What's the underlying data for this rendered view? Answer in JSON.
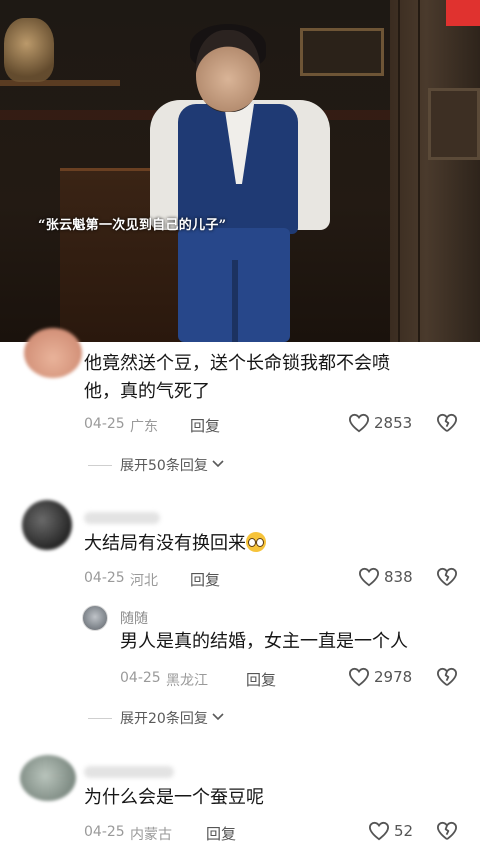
{
  "video": {
    "caption": "“张云魁第一次见到自己的儿子”"
  },
  "comments": [
    {
      "text_line1": "他竟然送个豆，送个长命锁我都不会喷",
      "text_line2": "他，真的气死了",
      "date": "04-25",
      "location": "广东",
      "reply_label": "回复",
      "likes": "2853",
      "expand_label": "展开50条回复"
    },
    {
      "text": "大结局有没有换回来",
      "emoji": "pleading-face-emoji",
      "date": "04-25",
      "location": "河北",
      "reply_label": "回复",
      "likes": "838",
      "reply": {
        "username": "随随",
        "text": "男人是真的结婚，女主一直是一个人",
        "date": "04-25",
        "location": "黑龙江",
        "reply_label": "回复",
        "likes": "2978"
      },
      "expand_label": "展开20条回复"
    },
    {
      "text": "为什么会是一个蚕豆呢",
      "date": "04-25",
      "location": "内蒙古",
      "reply_label": "回复",
      "likes": "52"
    }
  ],
  "icons": {
    "like": "heart-outline-icon",
    "dislike": "broken-heart-icon",
    "expand": "chevron-down-icon"
  },
  "colors": {
    "text": "#161616",
    "meta": "#9a9a9a",
    "action": "#555555"
  }
}
